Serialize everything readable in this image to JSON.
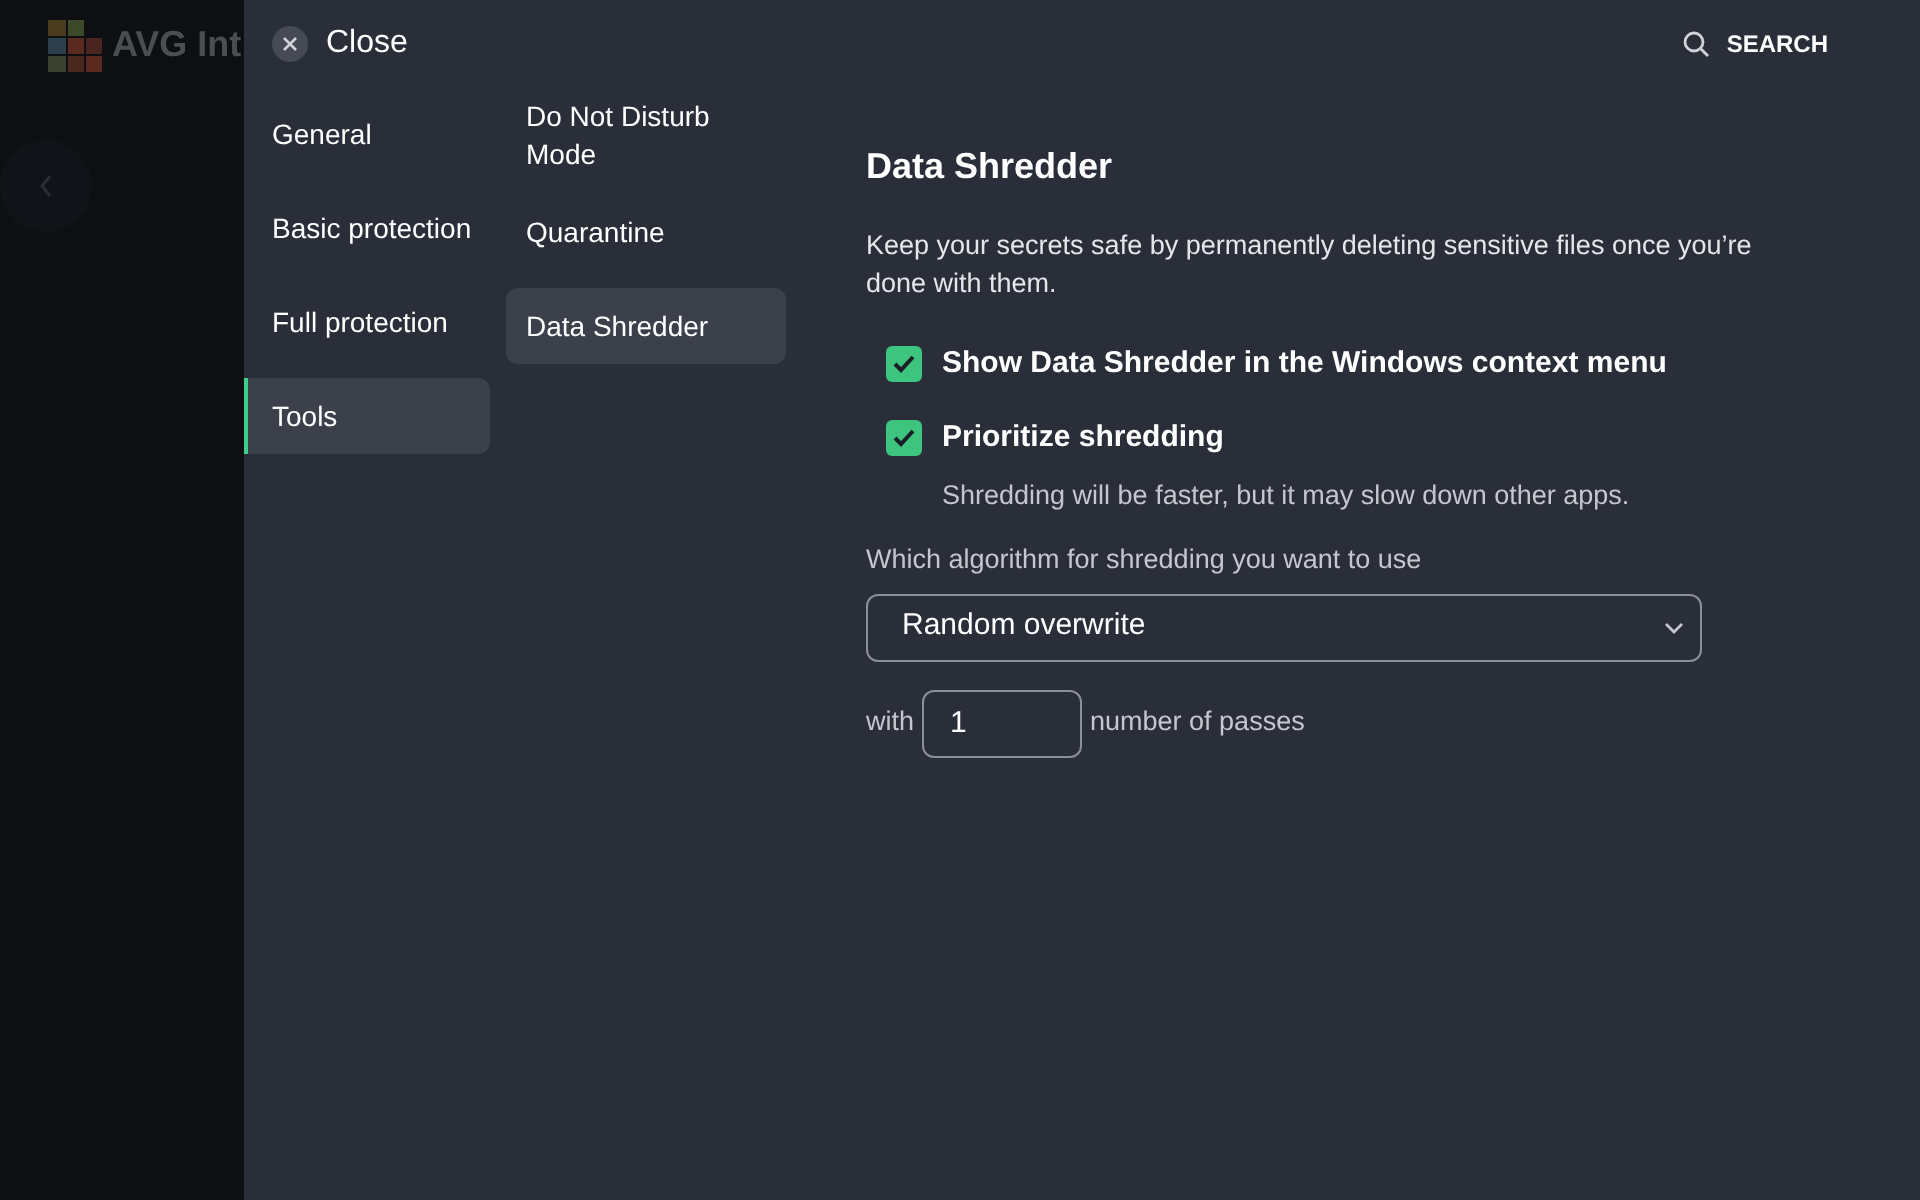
{
  "background_app": {
    "logo_text": "AVG Int"
  },
  "header": {
    "close_label": "Close",
    "search_label": "SEARCH"
  },
  "categories": [
    {
      "label": "General",
      "selected": false
    },
    {
      "label": "Basic protection",
      "selected": false
    },
    {
      "label": "Full protection",
      "selected": false
    },
    {
      "label": "Tools",
      "selected": true
    }
  ],
  "subcategories": [
    {
      "label": "Do Not Disturb Mode",
      "selected": false
    },
    {
      "label": "Quarantine",
      "selected": false
    },
    {
      "label": "Data Shredder",
      "selected": true
    }
  ],
  "content": {
    "title": "Data Shredder",
    "description": "Keep your secrets safe by permanently deleting sensitive files once you’re done with them.",
    "options": [
      {
        "label": "Show Data Shredder in the Windows context menu",
        "checked": true
      },
      {
        "label": "Prioritize shredding",
        "checked": true,
        "hint": "Shredding will be faster, but it may slow down other apps."
      }
    ],
    "algorithm_label": "Which algorithm for shredding you want to use",
    "algorithm_value": "Random overwrite",
    "passes_prefix": "with",
    "passes_value": "1",
    "passes_suffix": "number of passes"
  }
}
